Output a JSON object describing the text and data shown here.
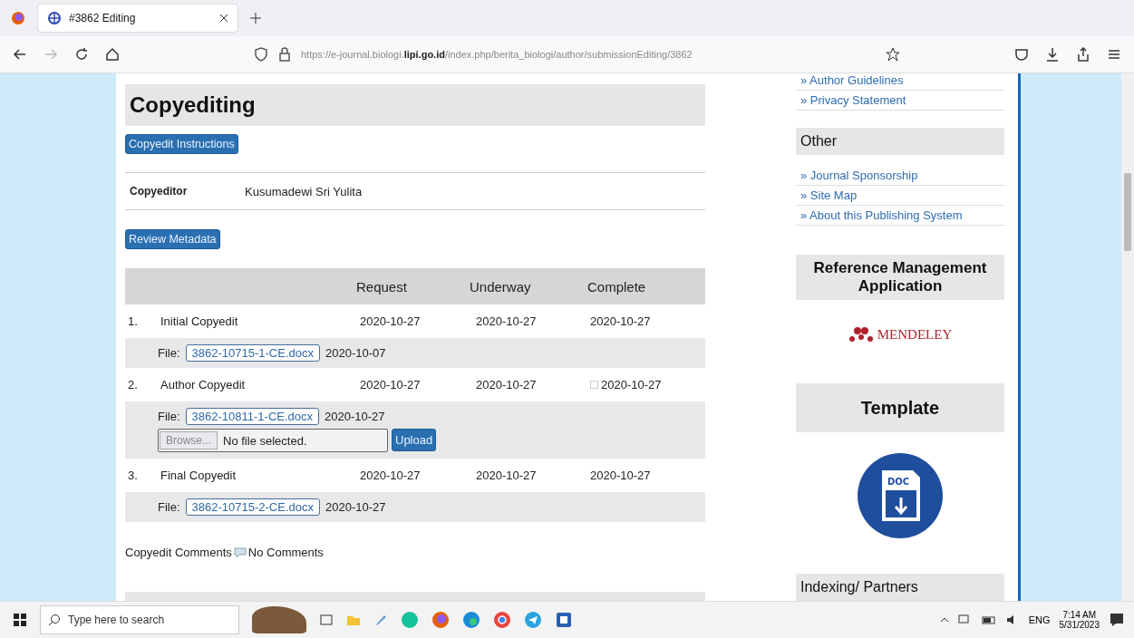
{
  "browser": {
    "tab": {
      "title": "#3862 Editing",
      "selected": true
    },
    "url": "https://e-journal.biologi.**lipi.go.id**/index.php/berita_biologi/author/submissionEditing/3862"
  },
  "main": {
    "heading": "Copyediting",
    "instructions_button": "Copyedit Instructions",
    "copyeditor_label": "Copyeditor",
    "copyeditor_name": "Kusumadewi Sri Yulita",
    "metadata_button": "Review Metadata",
    "table": {
      "columns": [
        "Request",
        "Underway",
        "Complete"
      ],
      "rows": [
        {
          "number": "1.",
          "task": "Initial Copyedit",
          "request": "2020-10-27",
          "underway": "2020-10-27",
          "complete": "2020-10-27",
          "mail_icon": false,
          "file_label": "File:",
          "file": "3862-10715-1-CE.docx",
          "file_date": "2020-10-07"
        },
        {
          "number": "2.",
          "task": "Author Copyedit",
          "request": "2020-10-27",
          "underway": "2020-10-27",
          "complete": "2020-10-27",
          "mail_icon": true,
          "file_label": "File:",
          "file": "3862-10811-1-CE.docx",
          "file_date": "2020-10-27",
          "upload": {
            "browse": "Browse...",
            "status": "No file selected.",
            "button": "Upload"
          }
        },
        {
          "number": "3.",
          "task": "Final Copyedit",
          "request": "2020-10-27",
          "underway": "2020-10-27",
          "complete": "2020-10-27",
          "mail_icon": false,
          "file_label": "File:",
          "file": "3862-10715-2-CE.docx",
          "file_date": "2020-10-27"
        }
      ]
    },
    "comments_label": "Copyedit Comments",
    "comments_value": "No Comments"
  },
  "sidebar": {
    "top_links": [
      "» Author Guidelines",
      "» Privacy Statement"
    ],
    "other_title": "Other",
    "other_links": [
      "» Journal Sponsorship",
      "» Site Map",
      "» About this Publishing System"
    ],
    "reference_title": "Reference Management Application",
    "mendeley": "MENDELEY",
    "template_title": "Template",
    "doc_label": "DOC",
    "indexing_title": "Indexing/ Partners"
  },
  "taskbar": {
    "search_placeholder": "Type here to search",
    "language": "ENG",
    "time": "7:14 AM",
    "date": "5/31/2023"
  }
}
